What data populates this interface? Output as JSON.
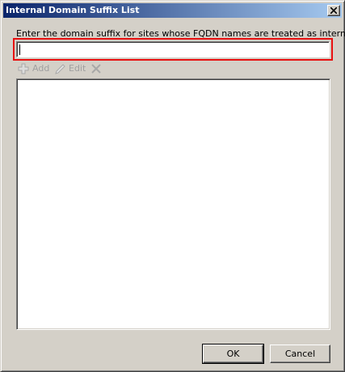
{
  "window": {
    "title": "Internal Domain Suffix List"
  },
  "form": {
    "prompt_label": "Enter the domain suffix for sites whose FQDN names are treated as internal:",
    "suffix_input_value": ""
  },
  "toolbar": {
    "add_label": "Add",
    "edit_label": "Edit",
    "add_icon": "plus-icon",
    "edit_icon": "pencil-icon",
    "delete_icon": "x-icon"
  },
  "list": {
    "items": []
  },
  "buttons": {
    "ok_label": "OK",
    "cancel_label": "Cancel"
  },
  "colors": {
    "titlebar_start": "#0a246a",
    "titlebar_end": "#a6caf0",
    "highlight_border": "#e81010",
    "disabled_text": "#a0a0a0",
    "window_bg": "#d4d0c8"
  }
}
